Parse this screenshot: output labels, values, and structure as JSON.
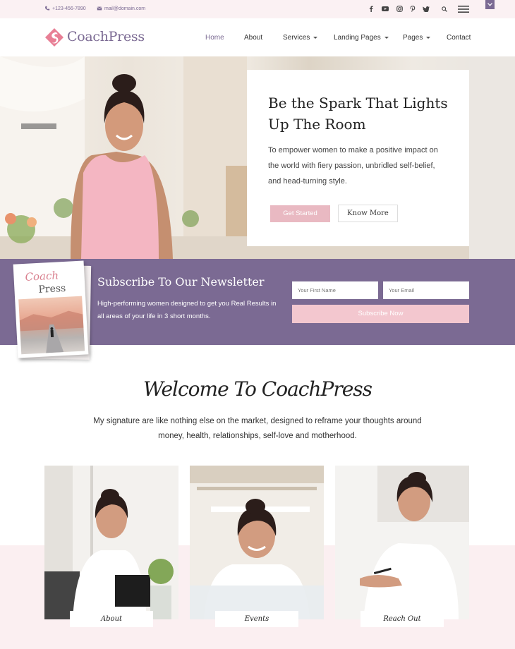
{
  "topbar": {
    "phone": "+123-456-7890",
    "email": "mail@domain.com",
    "social": [
      "facebook-icon",
      "youtube-icon",
      "instagram-icon",
      "pinterest-icon",
      "twitter-icon"
    ]
  },
  "header": {
    "logo_text": "CoachPress",
    "nav": [
      {
        "label": "Home",
        "active": true
      },
      {
        "label": "About"
      },
      {
        "label": "Services",
        "dropdown": true
      },
      {
        "label": "Landing Pages",
        "dropdown": true
      },
      {
        "label": "Pages",
        "dropdown": true
      },
      {
        "label": "Contact"
      }
    ]
  },
  "hero": {
    "title": "Be the Spark That Lights Up The Room",
    "description": "To empower women to make a positive impact on the world with fiery passion, unbridled self-belief, and head-turning style.",
    "primary_button": "Get Started",
    "secondary_button": "Know More"
  },
  "newsletter": {
    "book_title_script": "Coach",
    "book_title": "Press",
    "title": "Subscribe To Our Newsletter",
    "description": "High-performing women designed to get you Real Results in all areas of your life in 3 short months.",
    "first_name_placeholder": "Your First Name",
    "email_placeholder": "Your Email",
    "submit_label": "Subscribe Now"
  },
  "welcome": {
    "title": "Welcome To CoachPress",
    "description": "My signature are like nothing else on the market, designed to reframe your thoughts around money, health, relationships, self-love and motherhood."
  },
  "cards": [
    {
      "label": "About"
    },
    {
      "label": "Events"
    },
    {
      "label": "Reach Out"
    }
  ],
  "colors": {
    "brand_purple": "#7b6a93",
    "accent_pink": "#e9b9c2",
    "topbar_bg": "#fbf1f3"
  }
}
